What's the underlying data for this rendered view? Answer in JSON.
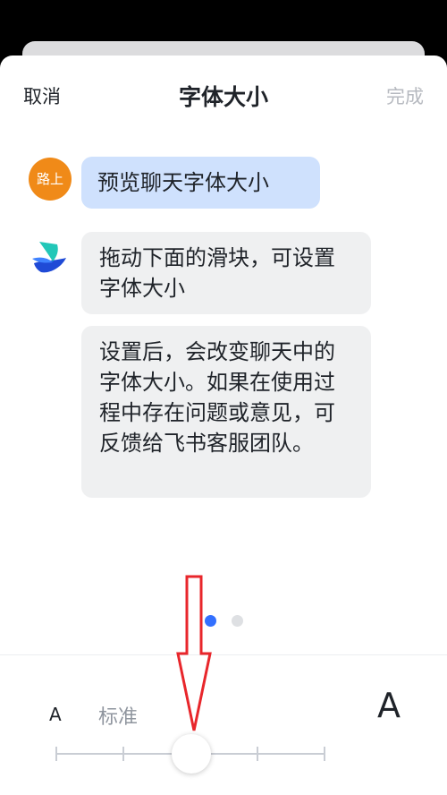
{
  "header": {
    "cancel_label": "取消",
    "title": "字体大小",
    "done_label": "完成"
  },
  "chat": {
    "user_avatar_text": "路上",
    "messages": [
      {
        "text": "预览聊天字体大小"
      },
      {
        "text": "拖动下面的滑块，可设置字体大小"
      },
      {
        "text": "设置后，会改变聊天中的字体大小。如果在使用过程中存在问题或意见，可反馈给飞书客服团队。"
      }
    ]
  },
  "pager": {
    "pages": 2,
    "active_index": 0
  },
  "font_size_control": {
    "small_label": "A",
    "current_label": "标准",
    "large_label": "A",
    "steps": 5,
    "selected_step": 2
  },
  "colors": {
    "accent": "#3370ff",
    "user_bubble": "#cfe1fd",
    "bot_bubble": "#eff0f1",
    "avatar_orange": "#f08a18",
    "annotation_arrow": "#e8262b"
  },
  "icons": {
    "bot_avatar": "feishu-bird-logo-icon"
  }
}
